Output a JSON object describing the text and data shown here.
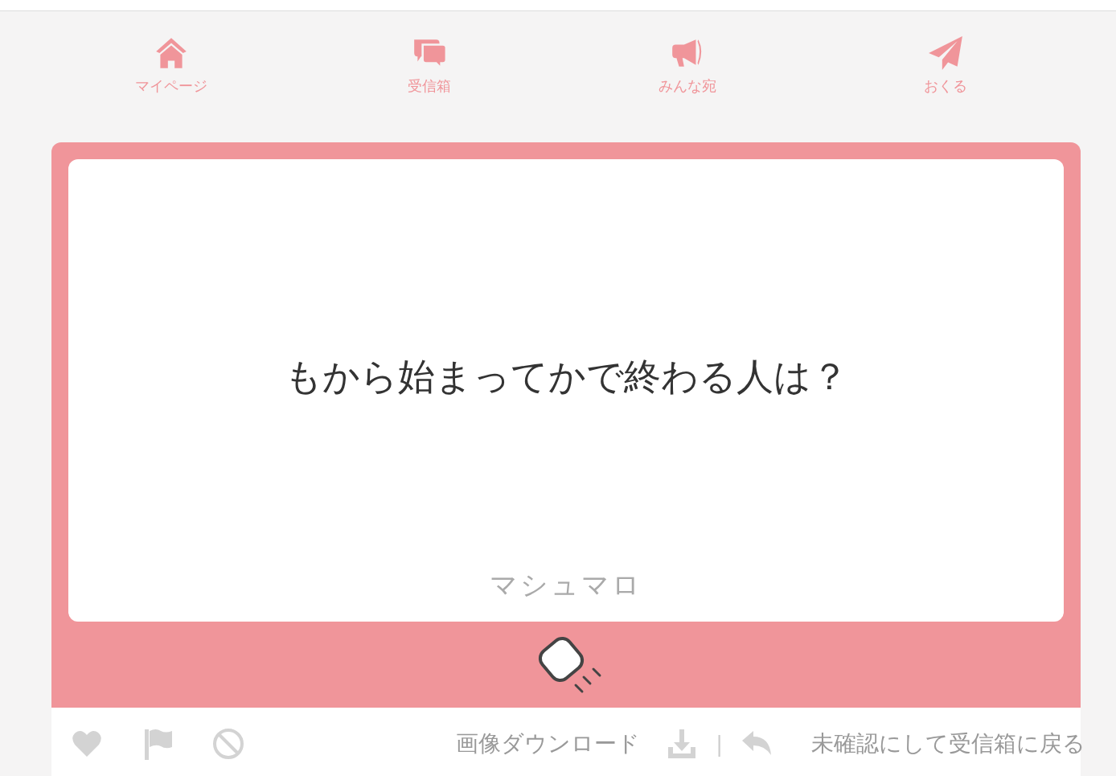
{
  "nav": [
    {
      "kind": "home",
      "label": "マイページ"
    },
    {
      "kind": "inbox",
      "label": "受信箱"
    },
    {
      "kind": "megaphone",
      "label": "みんな宛"
    },
    {
      "kind": "send",
      "label": "おくる"
    }
  ],
  "message": {
    "text": "もから始まってかで終わる人は？",
    "brand": "マシュマロ"
  },
  "footer": {
    "actions": [
      {
        "kind": "heart"
      },
      {
        "kind": "flag"
      },
      {
        "kind": "block"
      }
    ],
    "download": "画像ダウンロード",
    "separator": "|",
    "back": "未確認にして受信箱に戻る"
  }
}
